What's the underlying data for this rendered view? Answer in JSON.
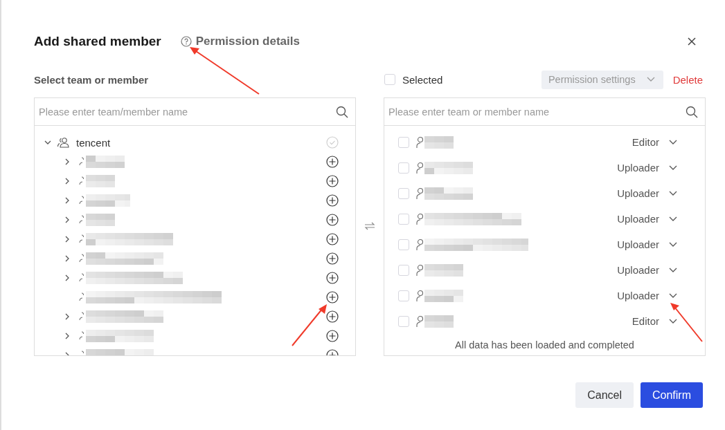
{
  "dialog": {
    "title": "Add shared member",
    "help_link": "Permission details"
  },
  "left": {
    "label": "Select team or member",
    "search": {
      "placeholder": "Please enter team/member name"
    },
    "tree": {
      "label": "tencent",
      "expanded": true,
      "added": true,
      "children": [
        {
          "expandable": true,
          "added": false
        },
        {
          "expandable": true,
          "added": false
        },
        {
          "expandable": true,
          "added": false
        },
        {
          "expandable": true,
          "added": false
        },
        {
          "expandable": true,
          "added": false
        },
        {
          "expandable": true,
          "added": false
        },
        {
          "expandable": true,
          "added": false
        },
        {
          "expandable": false,
          "added": false
        },
        {
          "expandable": true,
          "added": false
        },
        {
          "expandable": true,
          "added": false
        },
        {
          "expandable": true,
          "added": false
        }
      ]
    }
  },
  "right": {
    "select_all": {
      "label": "Selected",
      "checked": false
    },
    "permission_settings": {
      "label": "Permission settings",
      "disabled": true
    },
    "delete": "Delete",
    "search": {
      "placeholder": "Please enter team or member name"
    },
    "members": [
      {
        "checked": false,
        "role": "Editor"
      },
      {
        "checked": false,
        "role": "Uploader"
      },
      {
        "checked": false,
        "role": "Uploader"
      },
      {
        "checked": false,
        "role": "Uploader"
      },
      {
        "checked": false,
        "role": "Uploader"
      },
      {
        "checked": false,
        "role": "Uploader"
      },
      {
        "checked": false,
        "role": "Uploader"
      },
      {
        "checked": false,
        "role": "Editor"
      }
    ],
    "footer": "All data has been loaded and completed"
  },
  "buttons": [
    {
      "label": "Cancel",
      "kind": "secondary"
    },
    {
      "label": "Confirm",
      "kind": "primary"
    }
  ]
}
